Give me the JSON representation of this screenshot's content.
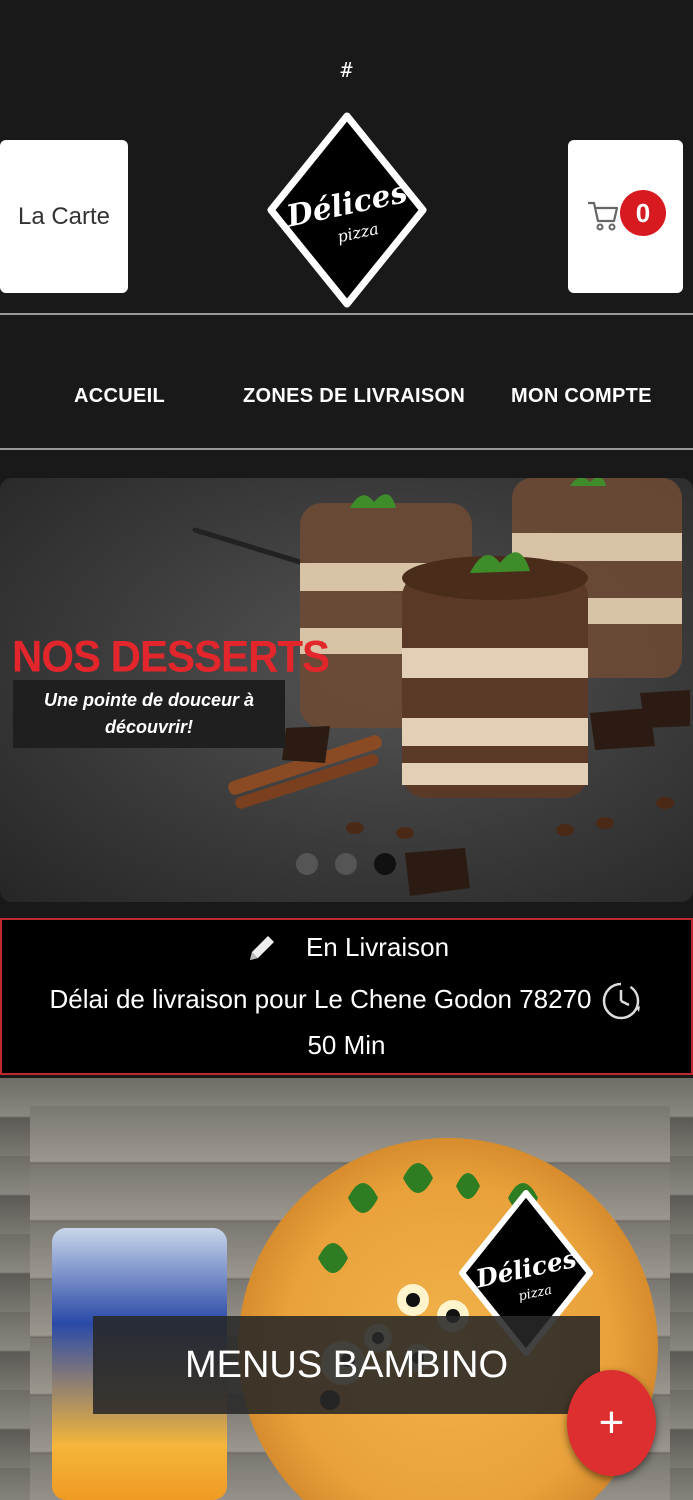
{
  "top_text": "#",
  "header": {
    "menu_button_label": "La Carte",
    "logo": {
      "text_line1": "Délices",
      "text_line2": "pizza"
    },
    "cart": {
      "icon": "cart-icon",
      "count": "0"
    }
  },
  "nav": {
    "items": [
      {
        "label": "ACCUEIL"
      },
      {
        "label": "ZONES DE LIVRAISON"
      },
      {
        "label": "MON COMPTE"
      }
    ]
  },
  "slider": {
    "title": "NOS DESSERTS",
    "subtitle": "Une pointe de douceur à\ndécouvrir!",
    "dots": 3,
    "active_dot": 3,
    "colors": {
      "title": "#e3262c"
    }
  },
  "delivery": {
    "mode": "En Livraison",
    "delay_text": "Délai de livraison pour Le Chene Godon 78270",
    "duration": "50 Min",
    "mode_icon": "pencil-icon",
    "delay_icon": "clock-icon",
    "colors": {
      "border": "#c0282f"
    }
  },
  "category_banner": {
    "label": "MENUS BAMBINO",
    "logo": {
      "text_line1": "Délices",
      "text_line2": "pizza"
    }
  },
  "fab": {
    "icon": "plus-icon",
    "symbol": "+"
  },
  "colors": {
    "accent": "#d71920",
    "background": "#1a1919"
  }
}
